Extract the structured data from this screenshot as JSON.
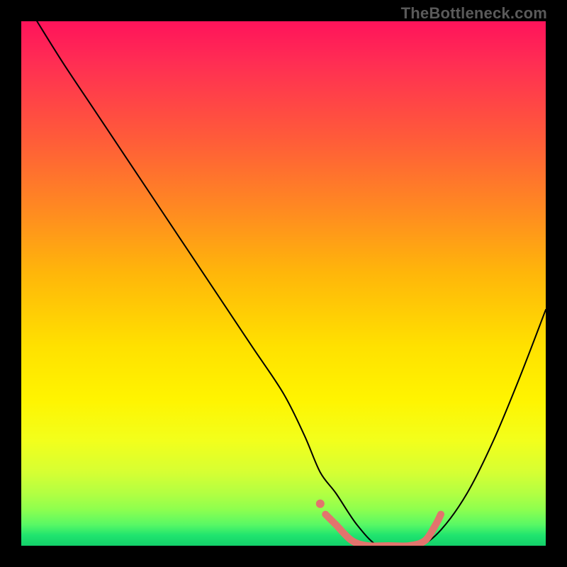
{
  "watermark": "TheBottleneck.com",
  "chart_data": {
    "type": "line",
    "title": "",
    "xlabel": "",
    "ylabel": "",
    "xlim": [
      0,
      100
    ],
    "ylim": [
      0,
      100
    ],
    "grid": false,
    "background_gradient": {
      "direction": "vertical",
      "stops": [
        {
          "pos": 0,
          "color": "#ff135b",
          "meaning": "high-bottleneck"
        },
        {
          "pos": 50,
          "color": "#ffd000",
          "meaning": "mid"
        },
        {
          "pos": 100,
          "color": "#13d06a",
          "meaning": "no-bottleneck"
        }
      ]
    },
    "series": [
      {
        "name": "bottleneck-curve",
        "color": "#000000",
        "width": 2,
        "x": [
          3,
          8,
          14,
          20,
          26,
          32,
          38,
          44,
          50,
          54,
          57,
          60,
          64,
          68,
          72,
          76,
          80,
          85,
          90,
          95,
          100
        ],
        "y": [
          100,
          92,
          83,
          74,
          65,
          56,
          47,
          38,
          29,
          21,
          14,
          10,
          4,
          0,
          0,
          0,
          3,
          10,
          20,
          32,
          45
        ]
      },
      {
        "name": "optimal-zone-highlight",
        "color": "#e2746d",
        "width": 10,
        "x": [
          58,
          60,
          63,
          66,
          70,
          74,
          77,
          79,
          80
        ],
        "y": [
          6,
          4,
          1,
          0,
          0,
          0,
          1,
          4,
          6
        ]
      }
    ],
    "markers": [
      {
        "name": "left-dot",
        "x": 57,
        "y": 8,
        "r": 6,
        "color": "#e2746d"
      }
    ]
  }
}
